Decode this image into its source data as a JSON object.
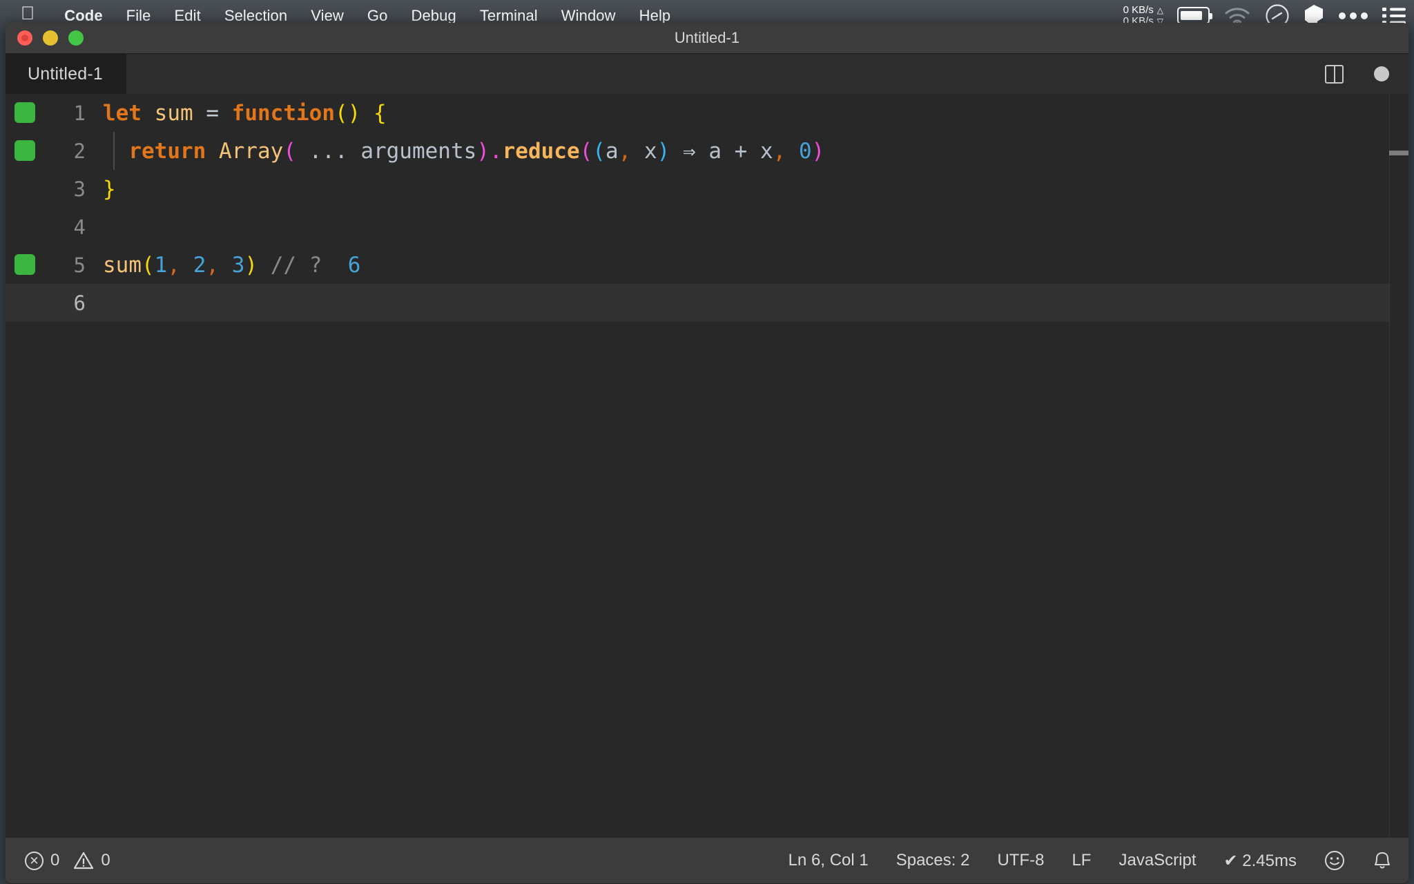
{
  "menubar": {
    "apple_icon": "apple-logo-icon",
    "items": [
      {
        "label": "Code",
        "bold": true
      },
      {
        "label": "File",
        "bold": false
      },
      {
        "label": "Edit",
        "bold": false
      },
      {
        "label": "Selection",
        "bold": false
      },
      {
        "label": "View",
        "bold": false
      },
      {
        "label": "Go",
        "bold": false
      },
      {
        "label": "Debug",
        "bold": false
      },
      {
        "label": "Terminal",
        "bold": false
      },
      {
        "label": "Window",
        "bold": false
      },
      {
        "label": "Help",
        "bold": false
      }
    ],
    "status": {
      "net_up": "0 KB/s",
      "net_down": "0 KB/s",
      "up_arrow": "△",
      "down_arrow": "▽",
      "battery_icon": "battery-icon",
      "wifi_icon": "wifi-icon",
      "speedometer_icon": "speedometer-icon",
      "cube_icon": "cube-icon",
      "ellipsis_icon": "ellipsis-icon",
      "list_icon": "control-center-list-icon"
    }
  },
  "window": {
    "title": "Untitled-1",
    "traffic_lights": [
      "close",
      "minimize",
      "zoom"
    ]
  },
  "tabbar": {
    "active_tab": "Untitled-1",
    "split_editor_icon": "split-editor-icon",
    "unsaved_dot": "unsaved-indicator-dot"
  },
  "editor": {
    "language": "JavaScript",
    "lines": [
      {
        "number": "1",
        "breakpoint": true,
        "current": false,
        "indent_guide": false,
        "tokens": [
          {
            "text": "let",
            "cls": "t-kw"
          },
          {
            "text": " ",
            "cls": "t-plain"
          },
          {
            "text": "sum",
            "cls": "t-var"
          },
          {
            "text": " ",
            "cls": "t-plain"
          },
          {
            "text": "=",
            "cls": "t-op"
          },
          {
            "text": " ",
            "cls": "t-plain"
          },
          {
            "text": "function",
            "cls": "t-kw2"
          },
          {
            "text": "()",
            "cls": "t-paren-y"
          },
          {
            "text": " ",
            "cls": "t-plain"
          },
          {
            "text": "{",
            "cls": "t-brace-y"
          }
        ]
      },
      {
        "number": "2",
        "breakpoint": true,
        "current": false,
        "indent_guide": true,
        "tokens": [
          {
            "text": "  ",
            "cls": "t-plain"
          },
          {
            "text": "return",
            "cls": "t-kw"
          },
          {
            "text": " ",
            "cls": "t-plain"
          },
          {
            "text": "Array",
            "cls": "t-var"
          },
          {
            "text": "(",
            "cls": "t-paren-m"
          },
          {
            "text": " ... ",
            "cls": "t-plain"
          },
          {
            "text": "arguments",
            "cls": "t-plain"
          },
          {
            "text": ")",
            "cls": "t-paren-m"
          },
          {
            "text": ".",
            "cls": "t-paren-m"
          },
          {
            "text": "reduce",
            "cls": "t-fn"
          },
          {
            "text": "(",
            "cls": "t-paren-m"
          },
          {
            "text": "(",
            "cls": "t-paren-c"
          },
          {
            "text": "a",
            "cls": "t-plain"
          },
          {
            "text": ",",
            "cls": "t-comma"
          },
          {
            "text": " x",
            "cls": "t-plain"
          },
          {
            "text": ")",
            "cls": "t-paren-c"
          },
          {
            "text": " ",
            "cls": "t-plain"
          },
          {
            "text": "⇒",
            "cls": "t-op"
          },
          {
            "text": " a + x",
            "cls": "t-plain"
          },
          {
            "text": ",",
            "cls": "t-comma"
          },
          {
            "text": " ",
            "cls": "t-plain"
          },
          {
            "text": "0",
            "cls": "t-num"
          },
          {
            "text": ")",
            "cls": "t-paren-m"
          }
        ]
      },
      {
        "number": "3",
        "breakpoint": false,
        "current": false,
        "indent_guide": false,
        "tokens": [
          {
            "text": "}",
            "cls": "t-brace-y"
          }
        ]
      },
      {
        "number": "4",
        "breakpoint": false,
        "current": false,
        "indent_guide": false,
        "tokens": []
      },
      {
        "number": "5",
        "breakpoint": true,
        "current": false,
        "indent_guide": false,
        "tokens": [
          {
            "text": "sum",
            "cls": "t-var"
          },
          {
            "text": "(",
            "cls": "t-paren-y"
          },
          {
            "text": "1",
            "cls": "t-num"
          },
          {
            "text": ",",
            "cls": "t-comma"
          },
          {
            "text": " ",
            "cls": "t-plain"
          },
          {
            "text": "2",
            "cls": "t-num"
          },
          {
            "text": ",",
            "cls": "t-comma"
          },
          {
            "text": " ",
            "cls": "t-plain"
          },
          {
            "text": "3",
            "cls": "t-num"
          },
          {
            "text": ")",
            "cls": "t-paren-y"
          },
          {
            "text": " ",
            "cls": "t-plain"
          },
          {
            "text": "// ?",
            "cls": "t-comment"
          },
          {
            "text": "  ",
            "cls": "t-plain"
          },
          {
            "text": "6",
            "cls": "t-num"
          }
        ]
      },
      {
        "number": "6",
        "breakpoint": false,
        "current": true,
        "indent_guide": false,
        "tokens": []
      }
    ],
    "overview_ruler_mark": true
  },
  "statusbar": {
    "errors_icon": "error-circle-icon",
    "errors_count": "0",
    "warnings_icon": "warning-triangle-icon",
    "warnings_count": "0",
    "cursor_position": "Ln 6, Col 1",
    "indentation": "Spaces: 2",
    "encoding": "UTF-8",
    "eol": "LF",
    "language_mode": "JavaScript",
    "quokka_status": "✔ 2.45ms",
    "feedback_icon": "smiley-icon",
    "notifications_icon": "bell-icon"
  },
  "colors": {
    "menubar_bg": "#3c4248",
    "titlebar_bg": "#3c3c3c",
    "tabbar_bg": "#2d2d2d",
    "tab_active_bg": "#1e1e1e",
    "editor_bg": "#282828",
    "statusbar_bg": "#3c3c3c",
    "breakpoint_green": "#3cb540",
    "accent_orange": "#e2761a",
    "accent_yellow": "#f5d807",
    "accent_blue": "#46a2d8",
    "accent_magenta": "#ee4ed8"
  }
}
